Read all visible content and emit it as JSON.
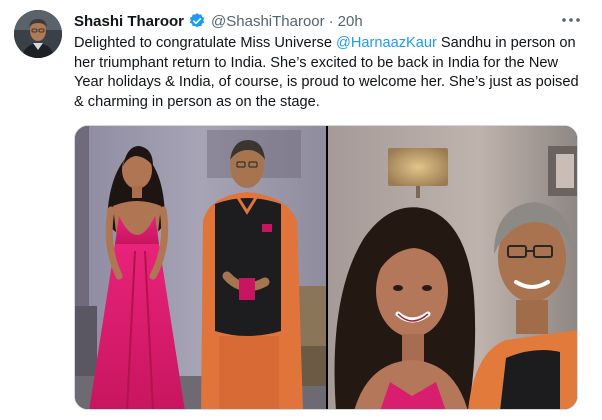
{
  "tweet": {
    "author": {
      "display_name": "Shashi Tharoor",
      "verified": true,
      "handle": "@ShashiTharoor",
      "separator": "·",
      "time": "20h"
    },
    "text": {
      "part1": "Delighted to congratulate Miss Universe ",
      "mention": "@HarnaazKaur",
      "part2": " Sandhu in person on her triumphant return to India. She’s excited to be back in India for the New Year holidays & India, of course, is proud to welcome her. She’s just as poised & charming in person as on the stage."
    },
    "media": {
      "photo_count": 2
    }
  },
  "icons": {
    "verified": "verified-badge-icon",
    "more": "more-options-icon"
  },
  "colors": {
    "accent": "#1d9bf0",
    "text": "#0f1419",
    "muted": "#536471",
    "border": "#cfd9de"
  }
}
